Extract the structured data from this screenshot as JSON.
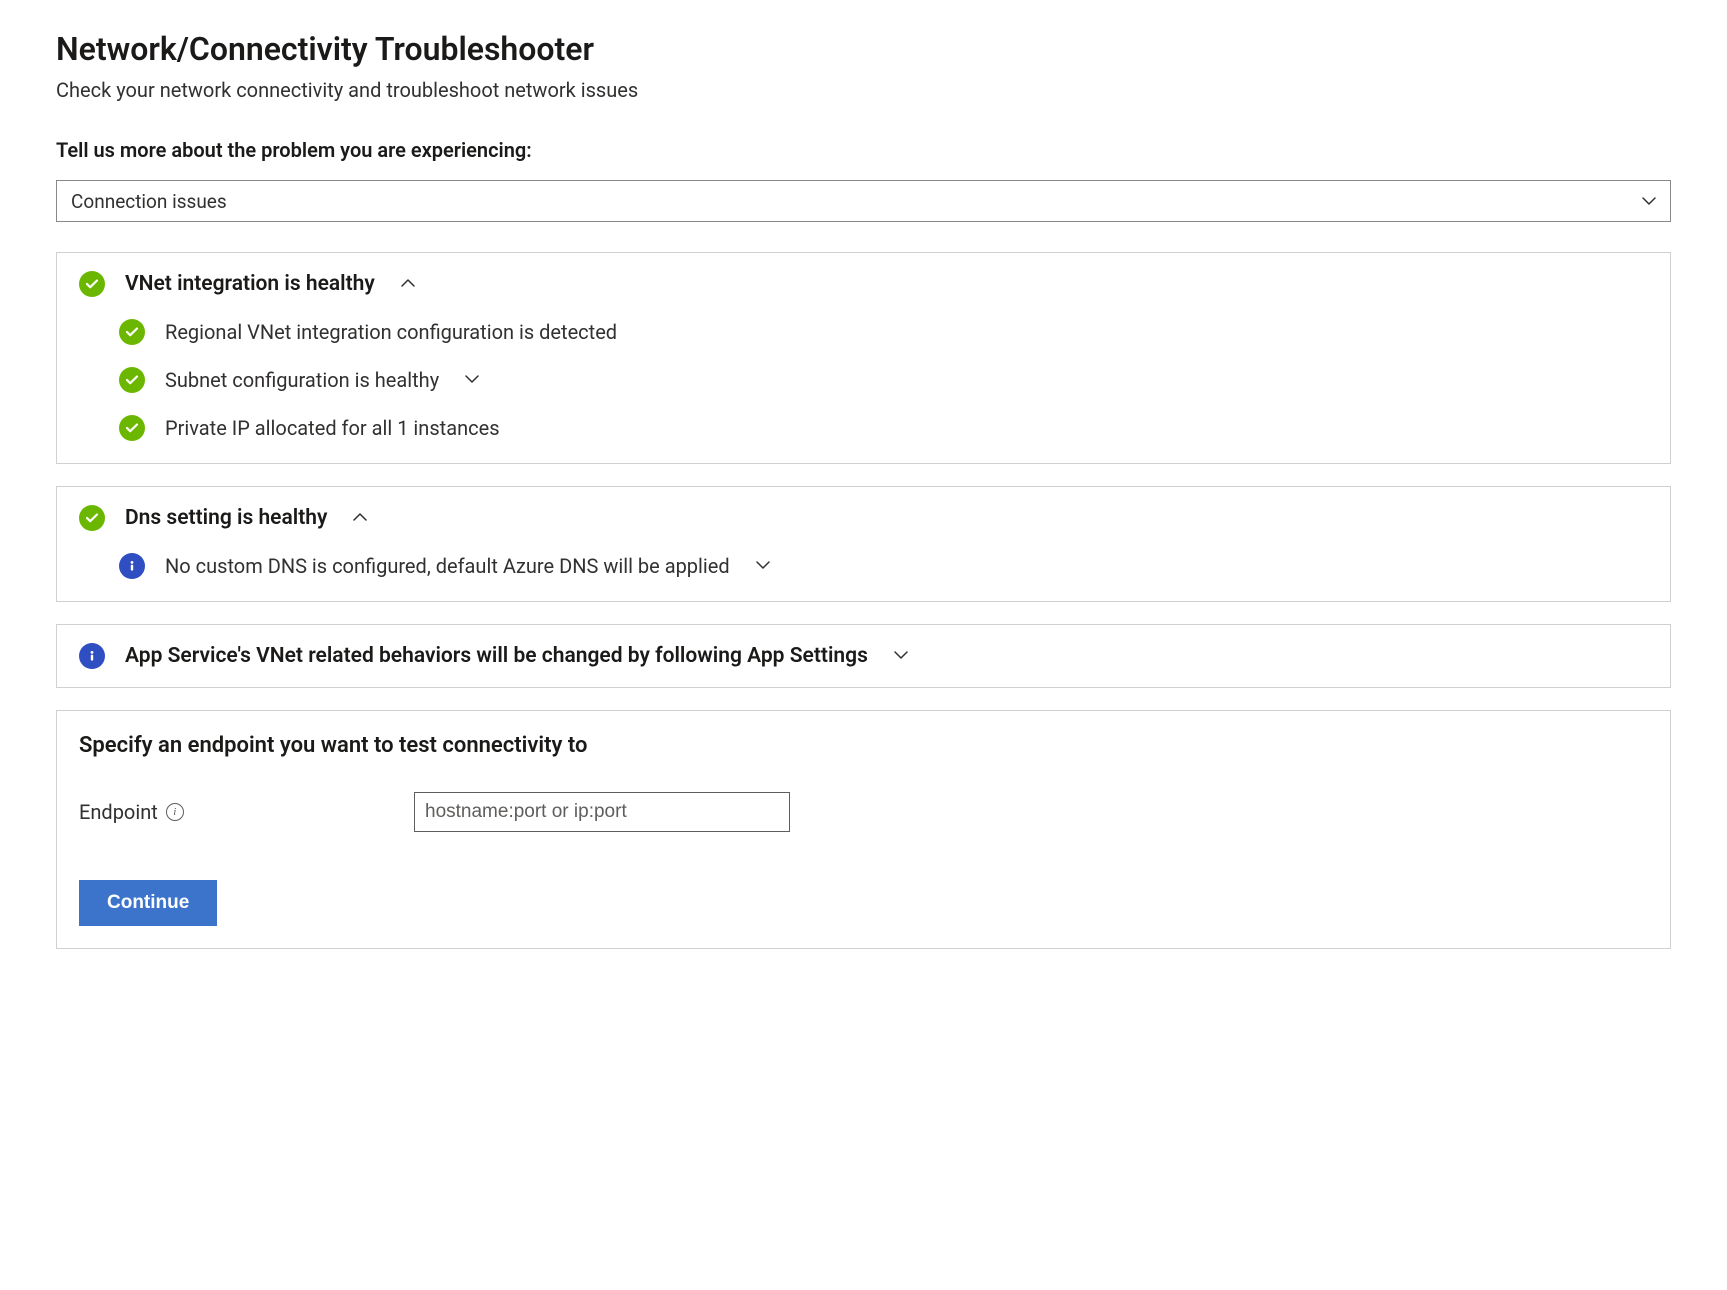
{
  "header": {
    "title": "Network/Connectivity Troubleshooter",
    "subtitle": "Check your network connectivity and troubleshoot network issues"
  },
  "problemPrompt": {
    "label": "Tell us more about the problem you are experiencing:",
    "selected": "Connection issues"
  },
  "sections": {
    "vnet": {
      "title": "VNet integration is healthy",
      "expanded": true,
      "items": {
        "regional": "Regional VNet integration configuration is detected",
        "subnet": "Subnet configuration is healthy",
        "privateIp": "Private IP allocated for all 1 instances"
      }
    },
    "dns": {
      "title": "Dns setting is healthy",
      "expanded": true,
      "items": {
        "noCustom": "No custom DNS is configured, default Azure DNS will be applied"
      }
    },
    "appSettings": {
      "title": "App Service's VNet related behaviors will be changed by following App Settings",
      "expanded": false
    }
  },
  "endpoint": {
    "title": "Specify an endpoint you want to test connectivity to",
    "label": "Endpoint",
    "placeholder": "hostname:port or ip:port",
    "value": ""
  },
  "actions": {
    "continue": "Continue"
  }
}
